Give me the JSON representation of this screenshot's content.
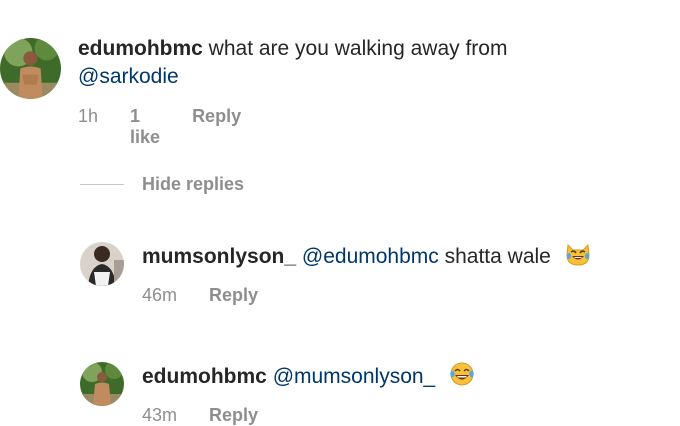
{
  "comments": [
    {
      "username": "edumohbmc",
      "text": " what are you walking away from",
      "mention": "@sarkodie",
      "time": "1h",
      "likes": "1 like",
      "reply": "Reply"
    }
  ],
  "hide_replies": "Hide replies",
  "replies": [
    {
      "username": "mumsonlyson_",
      "mention": "@edumohbmc",
      "text": " shatta wale",
      "emoji": "crying-laughing-cat-icon",
      "time": "46m",
      "reply": "Reply"
    },
    {
      "username": "edumohbmc",
      "mention": "@mumsonlyson_",
      "text": "",
      "emoji": "tears-of-joy-icon",
      "time": "43m",
      "reply": "Reply"
    }
  ],
  "colors": {
    "text": "#262626",
    "mention": "#00376b",
    "muted": "#8e8e8e",
    "avatar_green": "#3f6b2a",
    "emoji_yellow": "#f7c23a"
  }
}
